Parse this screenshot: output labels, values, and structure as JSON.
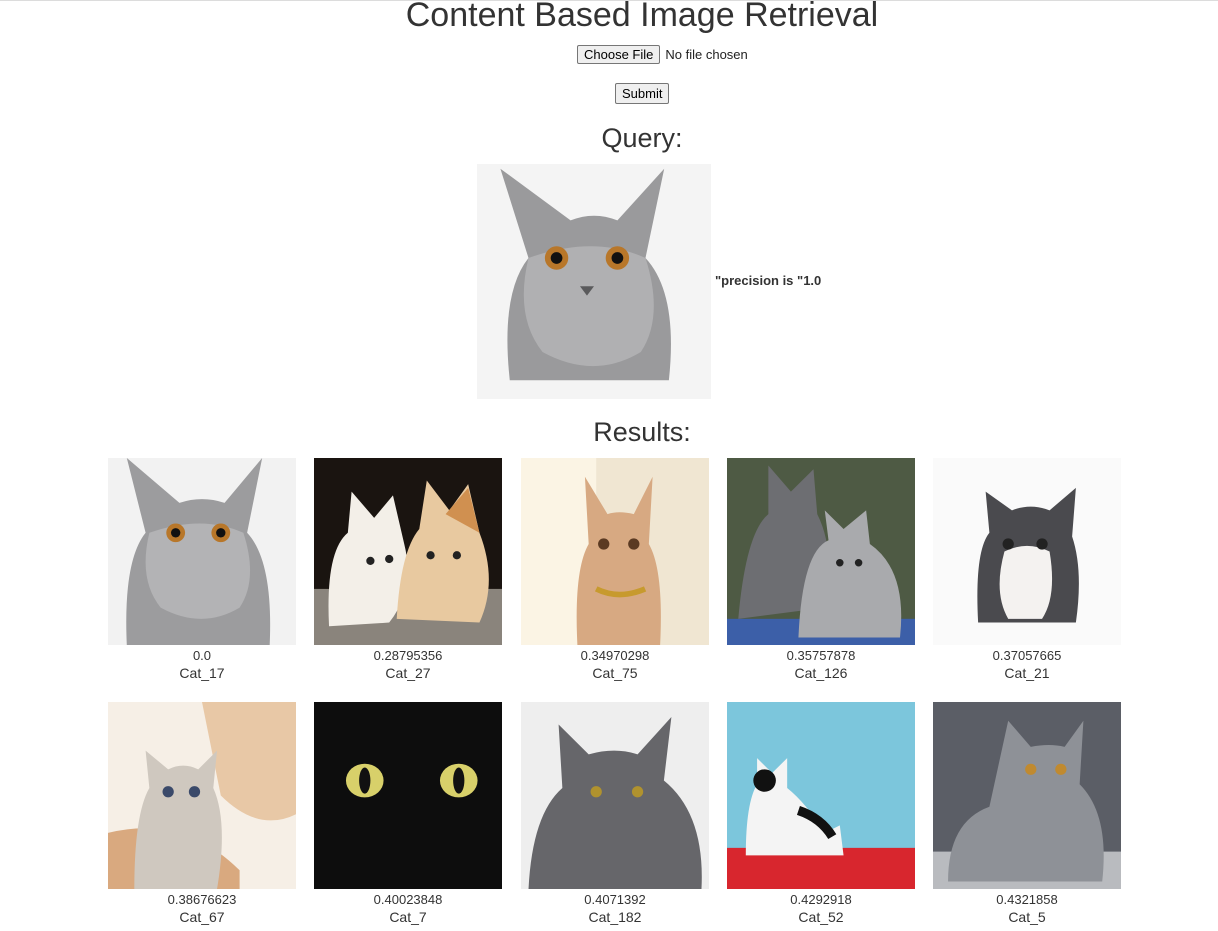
{
  "page": {
    "title": "Content Based Image Retrieval",
    "choose_file_label": "Choose File",
    "file_status": "No file chosen",
    "submit_label": "Submit",
    "query_heading": "Query:",
    "precision_text": "\"precision is \"1.0",
    "results_heading": "Results:"
  },
  "query": {
    "image_desc": "grey-cat-portrait"
  },
  "results": [
    {
      "distance": "0.0",
      "label": "Cat_17"
    },
    {
      "distance": "0.28795356",
      "label": "Cat_27"
    },
    {
      "distance": "0.34970298",
      "label": "Cat_75"
    },
    {
      "distance": "0.35757878",
      "label": "Cat_126"
    },
    {
      "distance": "0.37057665",
      "label": "Cat_21"
    },
    {
      "distance": "0.38676623",
      "label": "Cat_67"
    },
    {
      "distance": "0.40023848",
      "label": "Cat_7"
    },
    {
      "distance": "0.4071392",
      "label": "Cat_182"
    },
    {
      "distance": "0.4292918",
      "label": "Cat_52"
    },
    {
      "distance": "0.4321858",
      "label": "Cat_5"
    }
  ]
}
